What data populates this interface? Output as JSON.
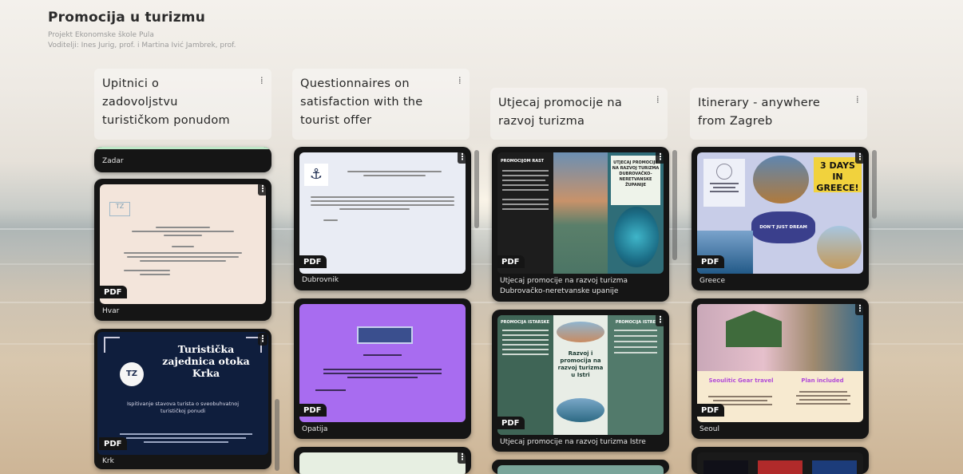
{
  "header": {
    "title": "Promocija u turizmu",
    "project_line": "Projekt Ekonomske škole Pula",
    "authors_line": "Voditelji: Ines Jurig, prof. i Martina Ivić Jambrek, prof."
  },
  "pdf_badge": "PDF",
  "kebab_glyph": "⋮",
  "columns": [
    {
      "title_lines": [
        "Upitnici o",
        "zadovoljstvu",
        "turističkom ponudom"
      ],
      "cards": [
        {
          "caption": "Zadar"
        },
        {
          "caption": "Hvar"
        },
        {
          "caption": "Krk",
          "thumb": {
            "line1": "Turistička",
            "line2": "zajednica otoka",
            "line3": "Krka",
            "logo": "TZ",
            "lead": "Ispitivanje stavova turista o sveobuhvatnoj turističkoj ponudi"
          }
        }
      ]
    },
    {
      "title_lines": [
        "Questionnaires on",
        "satisfaction with the",
        "tourist offer"
      ],
      "cards": [
        {
          "caption": "Dubrovnik"
        },
        {
          "caption": "Opatija"
        }
      ]
    },
    {
      "title_lines": [
        "Utjecaj promocije na",
        "razvoj turizma"
      ],
      "cards": [
        {
          "caption_lines": [
            "Utjecaj promocije na razvoj turizma",
            "Dubrovačko-neretvanske upanije"
          ],
          "thumb": {
            "left_title": "PROMOCIJOM RAST",
            "right_title": "UTJECAJ PROMOCIJE NA RAZVOJ TURIZMA DUBROVAČKO-NERETVANSKE ŽUPANIJE"
          }
        },
        {
          "caption": "Utjecaj promocije na razvoj turizma Istre",
          "thumb": {
            "center": "Razvoj i promocija na razvoj turizma u Istri",
            "left_title": "PROMOCIJA ISTARSKE",
            "right_title": "PROMOCIJA ISTRE"
          }
        }
      ]
    },
    {
      "title_lines": [
        "Itinerary - anywhere",
        "from Zagreb"
      ],
      "cards": [
        {
          "caption": "Greece",
          "thumb": {
            "banner": "3 DAYS IN GREECE!",
            "mid": "DON'T JUST DREAM"
          }
        },
        {
          "caption": "Seoul",
          "thumb": {
            "left": "Seoulitic Gear travel",
            "right": "Plan included"
          }
        }
      ]
    }
  ],
  "colors": {
    "card_bg": "#151515",
    "accent_green": "#4f7566",
    "lilac": "#a86cf0",
    "navy": "#0f1e3d",
    "cream": "#f2e4da"
  }
}
